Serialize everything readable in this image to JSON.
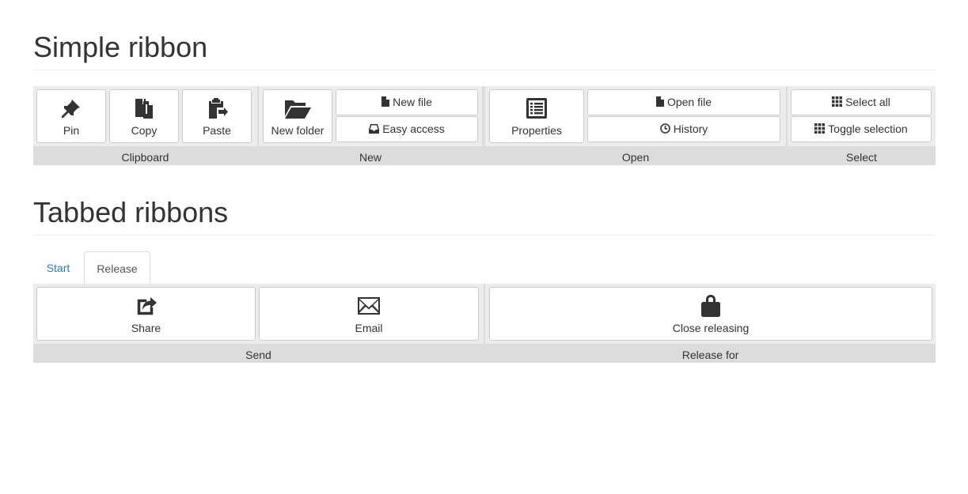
{
  "simple": {
    "heading": "Simple ribbon",
    "groups": {
      "clipboard": {
        "label": "Clipboard",
        "pin": "Pin",
        "copy": "Copy",
        "paste": "Paste"
      },
      "new": {
        "label": "New",
        "new_folder": "New folder",
        "new_file": "New file",
        "easy_access": "Easy access"
      },
      "open": {
        "label": "Open",
        "properties": "Properties",
        "open_file": "Open file",
        "history": "History"
      },
      "select": {
        "label": "Select",
        "select_all": "Select all",
        "toggle_selection": "Toggle selection"
      }
    }
  },
  "tabbed": {
    "heading": "Tabbed ribbons",
    "tabs": [
      {
        "label": "Start",
        "active": false
      },
      {
        "label": "Release",
        "active": true
      }
    ],
    "groups": {
      "send": {
        "label": "Send",
        "share": "Share",
        "email": "Email"
      },
      "release_for": {
        "label": "Release for",
        "close_releasing": "Close releasing"
      }
    }
  },
  "icons": {
    "pin": "pushpin-icon",
    "copy": "copy-icon",
    "paste": "paste-icon",
    "new_folder": "folder-open-icon",
    "new_file": "file-icon",
    "easy_access": "inbox-icon",
    "properties": "list-alt-icon",
    "open_file": "file-icon",
    "history": "clock-icon",
    "select_all": "grid-icon",
    "toggle_selection": "grid-icon",
    "share": "share-icon",
    "email": "envelope-icon",
    "close_releasing": "lock-icon"
  },
  "colors": {
    "ribbon_bg": "#dcdcdc",
    "group_bg": "#ececec",
    "button_border": "#cccccc",
    "tab_link": "#337ab7"
  }
}
